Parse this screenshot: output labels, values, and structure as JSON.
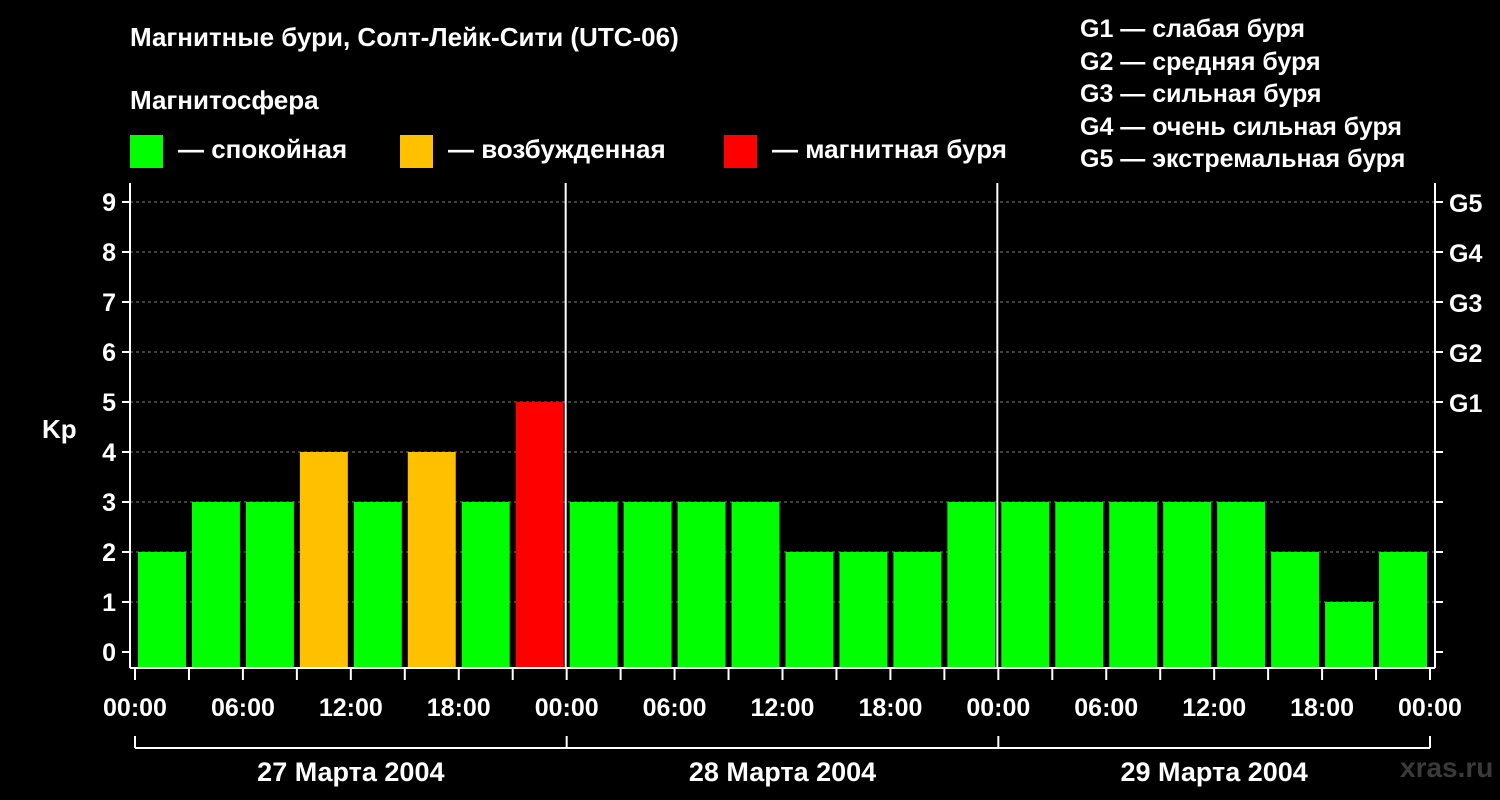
{
  "header": {
    "title": "Магнитные бури, Солт-Лейк-Сити (UTC-06)",
    "subtitle": "Магнитосфера"
  },
  "legend": {
    "items": [
      {
        "label": "— спокойная",
        "color": "#00ff00"
      },
      {
        "label": "— возбужденная",
        "color": "#ffc000"
      },
      {
        "label": "— магнитная буря",
        "color": "#ff0000"
      }
    ]
  },
  "g_legend": [
    "G1 — слабая буря",
    "G2 — средняя буря",
    "G3 — сильная буря",
    "G4 — очень сильная буря",
    "G5 — экстремальная буря"
  ],
  "watermark": "xras.ru",
  "colors": {
    "quiet": "#00ff00",
    "active": "#ffc000",
    "storm": "#ff0000",
    "background": "#000000",
    "grid": "#808080"
  },
  "chart_data": {
    "type": "bar",
    "title": "Магнитные бури, Солт-Лейк-Сити (UTC-06)",
    "ylabel": "Kp",
    "ylim": [
      0,
      9
    ],
    "yticks": [
      "0",
      "1",
      "2",
      "3",
      "4",
      "5",
      "6",
      "7",
      "8",
      "9"
    ],
    "right_ticks": [
      {
        "kp": 5,
        "label": "G1"
      },
      {
        "kp": 6,
        "label": "G2"
      },
      {
        "kp": 7,
        "label": "G3"
      },
      {
        "kp": 8,
        "label": "G4"
      },
      {
        "kp": 9,
        "label": "G5"
      }
    ],
    "xtick_labels": [
      "00:00",
      "06:00",
      "12:00",
      "18:00",
      "00:00",
      "06:00",
      "12:00",
      "18:00",
      "00:00",
      "06:00",
      "12:00",
      "18:00",
      "00:00"
    ],
    "days": [
      "27 Марта 2004",
      "28 Марта 2004",
      "29 Марта 2004"
    ],
    "grid": "dashed horizontal",
    "values": [
      2,
      3,
      3,
      4,
      3,
      4,
      3,
      5,
      3,
      3,
      3,
      3,
      2,
      2,
      2,
      3,
      3,
      3,
      3,
      3,
      3,
      2,
      1,
      2
    ],
    "levels": [
      "quiet",
      "quiet",
      "quiet",
      "active",
      "quiet",
      "active",
      "quiet",
      "storm",
      "quiet",
      "quiet",
      "quiet",
      "quiet",
      "quiet",
      "quiet",
      "quiet",
      "quiet",
      "quiet",
      "quiet",
      "quiet",
      "quiet",
      "quiet",
      "quiet",
      "quiet",
      "quiet"
    ]
  }
}
